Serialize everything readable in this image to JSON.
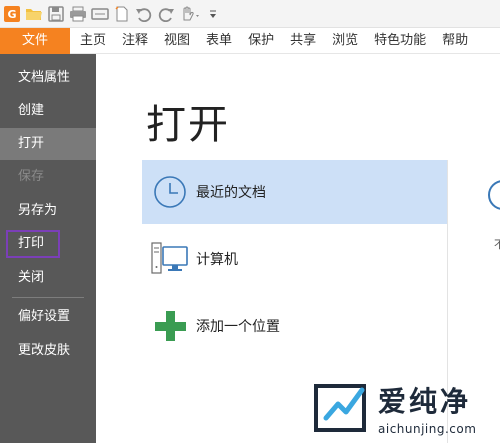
{
  "quick_access": {
    "icons": [
      "app-logo-icon",
      "open-folder-icon",
      "save-icon",
      "print-icon",
      "scan-icon",
      "new-doc-icon",
      "undo-icon",
      "redo-icon",
      "hand-tool-icon",
      "customize-icon"
    ],
    "colors": {
      "logo": "#f58220",
      "folder": "#f2c141",
      "icon": "#8a8a8a"
    }
  },
  "ribbon": {
    "file_tab": "文件",
    "tabs": [
      "主页",
      "注释",
      "视图",
      "表单",
      "保护",
      "共享",
      "浏览",
      "特色功能",
      "帮助"
    ]
  },
  "sidebar": {
    "items": [
      {
        "label": "文档属性",
        "state": "normal"
      },
      {
        "label": "创建",
        "state": "normal"
      },
      {
        "label": "打开",
        "state": "active"
      },
      {
        "label": "保存",
        "state": "disabled"
      },
      {
        "label": "另存为",
        "state": "normal"
      },
      {
        "label": "打印",
        "state": "highlighted"
      },
      {
        "label": "关闭",
        "state": "normal"
      },
      {
        "label": "偏好设置",
        "state": "normal"
      },
      {
        "label": "更改皮肤",
        "state": "normal"
      }
    ],
    "colors": {
      "background": "#585858",
      "active": "#7a7a7a",
      "highlight_border": "#7b3fb8"
    }
  },
  "main": {
    "title": "打开",
    "options": [
      {
        "label": "最近的文档",
        "icon": "clock-icon",
        "selected": true
      },
      {
        "label": "计算机",
        "icon": "computer-icon",
        "selected": false
      },
      {
        "label": "添加一个位置",
        "icon": "plus-icon",
        "selected": false
      }
    ],
    "right_panel_partial_text": "不",
    "colors": {
      "selected_bg": "#cde0f7",
      "plus": "#3a9c52",
      "clock": "#3a78b7"
    }
  },
  "watermark": {
    "title": "爱纯净",
    "url": "aichunjing.com"
  }
}
